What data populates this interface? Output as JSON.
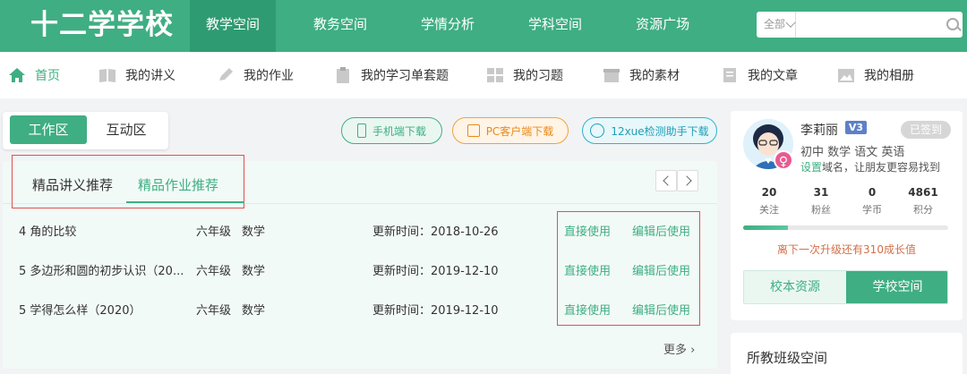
{
  "header": {
    "logo": "十二学学校",
    "nav": [
      "教学空间",
      "教务空间",
      "学情分析",
      "学科空间",
      "资源广场"
    ],
    "active_nav": "教学空间",
    "search": {
      "scope": "全部",
      "placeholder": ""
    },
    "colors": {
      "brand": "#3fae83",
      "active_nav_bg": "#2f9b72"
    }
  },
  "subnav": {
    "items": [
      {
        "label": "首页",
        "icon": "home-icon"
      },
      {
        "label": "我的讲义",
        "icon": "book-icon"
      },
      {
        "label": "我的作业",
        "icon": "pencil-icon"
      },
      {
        "label": "我的学习单套题",
        "icon": "clipboard-icon"
      },
      {
        "label": "我的习题",
        "icon": "grid-icon"
      },
      {
        "label": "我的素材",
        "icon": "box-icon"
      },
      {
        "label": "我的文章",
        "icon": "document-icon"
      },
      {
        "label": "我的相册",
        "icon": "image-icon"
      }
    ]
  },
  "workspace": {
    "tabs": [
      "工作区",
      "互动区"
    ],
    "downloads": [
      "手机端下载",
      "PC客户端下载",
      "12xue检测助手下载"
    ]
  },
  "recommend": {
    "tabs": [
      "精品讲义推荐",
      "精品作业推荐"
    ],
    "active_tab": "精品作业推荐",
    "rows": [
      {
        "title": "4 角的比较",
        "grade": "六年级",
        "subject": "数学",
        "updated": "更新时间：2018-10-26",
        "use": "直接使用",
        "edit": "编辑后使用"
      },
      {
        "title": "5 多边形和圆的初步认识（20...",
        "grade": "六年级",
        "subject": "数学",
        "updated": "更新时间：2019-12-10",
        "use": "直接使用",
        "edit": "编辑后使用"
      },
      {
        "title": "5 学得怎么样（2020）",
        "grade": "六年级",
        "subject": "数学",
        "updated": "更新时间：2019-12-10",
        "use": "直接使用",
        "edit": "编辑后使用"
      }
    ],
    "more": "更多"
  },
  "profile": {
    "name": "李莉丽",
    "level": "V3",
    "signed": "已签到",
    "subjects": "初中 数学 语文 英语",
    "hint_link": "设置",
    "hint_rest": "域名，让朋友更容易找到",
    "stats": [
      {
        "n": "20",
        "l": "关注"
      },
      {
        "n": "31",
        "l": "粉丝"
      },
      {
        "n": "0",
        "l": "学币"
      },
      {
        "n": "4861",
        "l": "积分"
      }
    ],
    "progress": 0.22,
    "upgrade": "离下一次升级还有310成长值",
    "switch": [
      "校本资源",
      "学校空间"
    ]
  },
  "classes": {
    "title": "所教班级空间"
  }
}
